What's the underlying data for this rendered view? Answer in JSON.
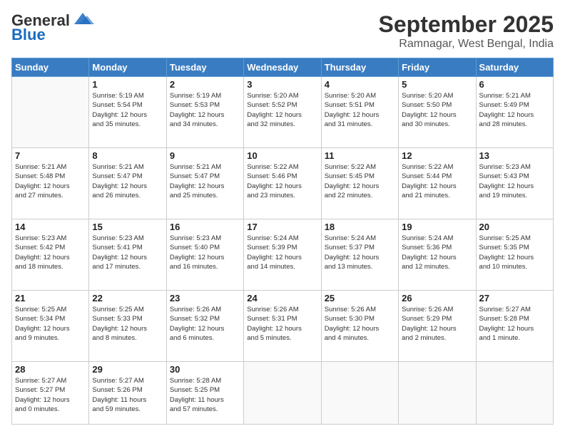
{
  "header": {
    "logo_general": "General",
    "logo_blue": "Blue",
    "month_title": "September 2025",
    "location": "Ramnagar, West Bengal, India"
  },
  "weekdays": [
    "Sunday",
    "Monday",
    "Tuesday",
    "Wednesday",
    "Thursday",
    "Friday",
    "Saturday"
  ],
  "weeks": [
    [
      {
        "day": "",
        "info": ""
      },
      {
        "day": "1",
        "info": "Sunrise: 5:19 AM\nSunset: 5:54 PM\nDaylight: 12 hours\nand 35 minutes."
      },
      {
        "day": "2",
        "info": "Sunrise: 5:19 AM\nSunset: 5:53 PM\nDaylight: 12 hours\nand 34 minutes."
      },
      {
        "day": "3",
        "info": "Sunrise: 5:20 AM\nSunset: 5:52 PM\nDaylight: 12 hours\nand 32 minutes."
      },
      {
        "day": "4",
        "info": "Sunrise: 5:20 AM\nSunset: 5:51 PM\nDaylight: 12 hours\nand 31 minutes."
      },
      {
        "day": "5",
        "info": "Sunrise: 5:20 AM\nSunset: 5:50 PM\nDaylight: 12 hours\nand 30 minutes."
      },
      {
        "day": "6",
        "info": "Sunrise: 5:21 AM\nSunset: 5:49 PM\nDaylight: 12 hours\nand 28 minutes."
      }
    ],
    [
      {
        "day": "7",
        "info": "Sunrise: 5:21 AM\nSunset: 5:48 PM\nDaylight: 12 hours\nand 27 minutes."
      },
      {
        "day": "8",
        "info": "Sunrise: 5:21 AM\nSunset: 5:47 PM\nDaylight: 12 hours\nand 26 minutes."
      },
      {
        "day": "9",
        "info": "Sunrise: 5:21 AM\nSunset: 5:47 PM\nDaylight: 12 hours\nand 25 minutes."
      },
      {
        "day": "10",
        "info": "Sunrise: 5:22 AM\nSunset: 5:46 PM\nDaylight: 12 hours\nand 23 minutes."
      },
      {
        "day": "11",
        "info": "Sunrise: 5:22 AM\nSunset: 5:45 PM\nDaylight: 12 hours\nand 22 minutes."
      },
      {
        "day": "12",
        "info": "Sunrise: 5:22 AM\nSunset: 5:44 PM\nDaylight: 12 hours\nand 21 minutes."
      },
      {
        "day": "13",
        "info": "Sunrise: 5:23 AM\nSunset: 5:43 PM\nDaylight: 12 hours\nand 19 minutes."
      }
    ],
    [
      {
        "day": "14",
        "info": "Sunrise: 5:23 AM\nSunset: 5:42 PM\nDaylight: 12 hours\nand 18 minutes."
      },
      {
        "day": "15",
        "info": "Sunrise: 5:23 AM\nSunset: 5:41 PM\nDaylight: 12 hours\nand 17 minutes."
      },
      {
        "day": "16",
        "info": "Sunrise: 5:23 AM\nSunset: 5:40 PM\nDaylight: 12 hours\nand 16 minutes."
      },
      {
        "day": "17",
        "info": "Sunrise: 5:24 AM\nSunset: 5:39 PM\nDaylight: 12 hours\nand 14 minutes."
      },
      {
        "day": "18",
        "info": "Sunrise: 5:24 AM\nSunset: 5:37 PM\nDaylight: 12 hours\nand 13 minutes."
      },
      {
        "day": "19",
        "info": "Sunrise: 5:24 AM\nSunset: 5:36 PM\nDaylight: 12 hours\nand 12 minutes."
      },
      {
        "day": "20",
        "info": "Sunrise: 5:25 AM\nSunset: 5:35 PM\nDaylight: 12 hours\nand 10 minutes."
      }
    ],
    [
      {
        "day": "21",
        "info": "Sunrise: 5:25 AM\nSunset: 5:34 PM\nDaylight: 12 hours\nand 9 minutes."
      },
      {
        "day": "22",
        "info": "Sunrise: 5:25 AM\nSunset: 5:33 PM\nDaylight: 12 hours\nand 8 minutes."
      },
      {
        "day": "23",
        "info": "Sunrise: 5:26 AM\nSunset: 5:32 PM\nDaylight: 12 hours\nand 6 minutes."
      },
      {
        "day": "24",
        "info": "Sunrise: 5:26 AM\nSunset: 5:31 PM\nDaylight: 12 hours\nand 5 minutes."
      },
      {
        "day": "25",
        "info": "Sunrise: 5:26 AM\nSunset: 5:30 PM\nDaylight: 12 hours\nand 4 minutes."
      },
      {
        "day": "26",
        "info": "Sunrise: 5:26 AM\nSunset: 5:29 PM\nDaylight: 12 hours\nand 2 minutes."
      },
      {
        "day": "27",
        "info": "Sunrise: 5:27 AM\nSunset: 5:28 PM\nDaylight: 12 hours\nand 1 minute."
      }
    ],
    [
      {
        "day": "28",
        "info": "Sunrise: 5:27 AM\nSunset: 5:27 PM\nDaylight: 12 hours\nand 0 minutes."
      },
      {
        "day": "29",
        "info": "Sunrise: 5:27 AM\nSunset: 5:26 PM\nDaylight: 11 hours\nand 59 minutes."
      },
      {
        "day": "30",
        "info": "Sunrise: 5:28 AM\nSunset: 5:25 PM\nDaylight: 11 hours\nand 57 minutes."
      },
      {
        "day": "",
        "info": ""
      },
      {
        "day": "",
        "info": ""
      },
      {
        "day": "",
        "info": ""
      },
      {
        "day": "",
        "info": ""
      }
    ]
  ]
}
